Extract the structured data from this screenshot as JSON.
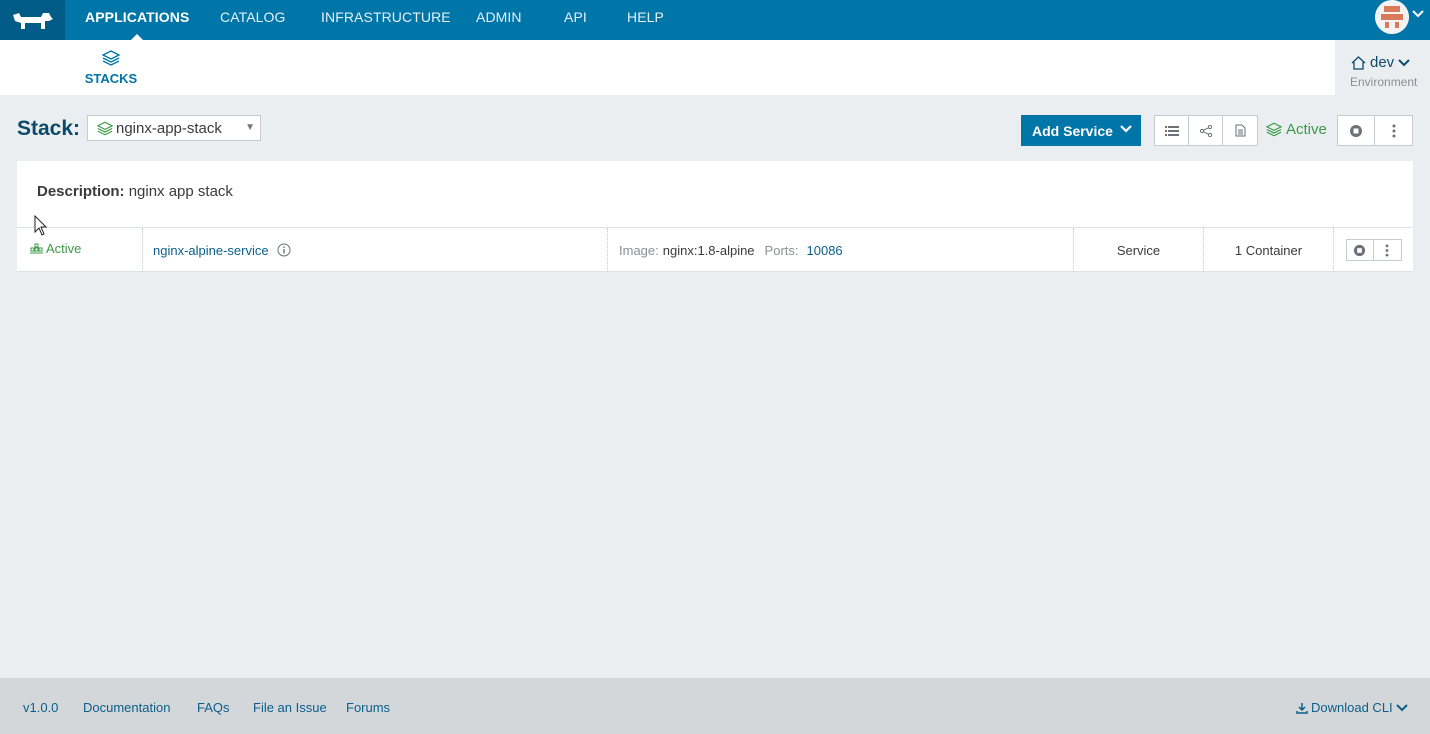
{
  "topnav": {
    "items": [
      {
        "label": "APPLICATIONS",
        "active": true
      },
      {
        "label": "CATALOG",
        "active": false
      },
      {
        "label": "INFRASTRUCTURE",
        "active": false
      },
      {
        "label": "ADMIN",
        "active": false
      },
      {
        "label": "API",
        "active": false
      },
      {
        "label": "HELP",
        "active": false
      }
    ],
    "logo_icon": "rancher-cow-icon",
    "avatar_icon": "user-avatar-icon"
  },
  "subnav": {
    "tab_label": "STACKS",
    "tab_icon": "layers-icon",
    "environment": {
      "name": "dev",
      "sub": "Environment",
      "icon": "home-icon"
    }
  },
  "stack": {
    "title": "Stack:",
    "selected": "nginx-app-stack",
    "add_service_label": "Add Service",
    "state": "Active",
    "description_key": "Description:",
    "description_value": "nginx app stack"
  },
  "services": [
    {
      "state": "Active",
      "name": "nginx-alpine-service",
      "image_key": "Image:",
      "image_value": "nginx:1.8-alpine",
      "ports_key": "Ports:",
      "ports_value": "10086",
      "kind": "Service",
      "containers": "1 Container"
    }
  ],
  "footer": {
    "version": "v1.0.0",
    "links": [
      "Documentation",
      "FAQs",
      "File an Issue",
      "Forums"
    ],
    "download": "Download CLI"
  },
  "colors": {
    "brand": "#0075a8",
    "brand_dark": "#005b87",
    "active_green": "#3d9a47",
    "link": "#0b5f8a"
  }
}
